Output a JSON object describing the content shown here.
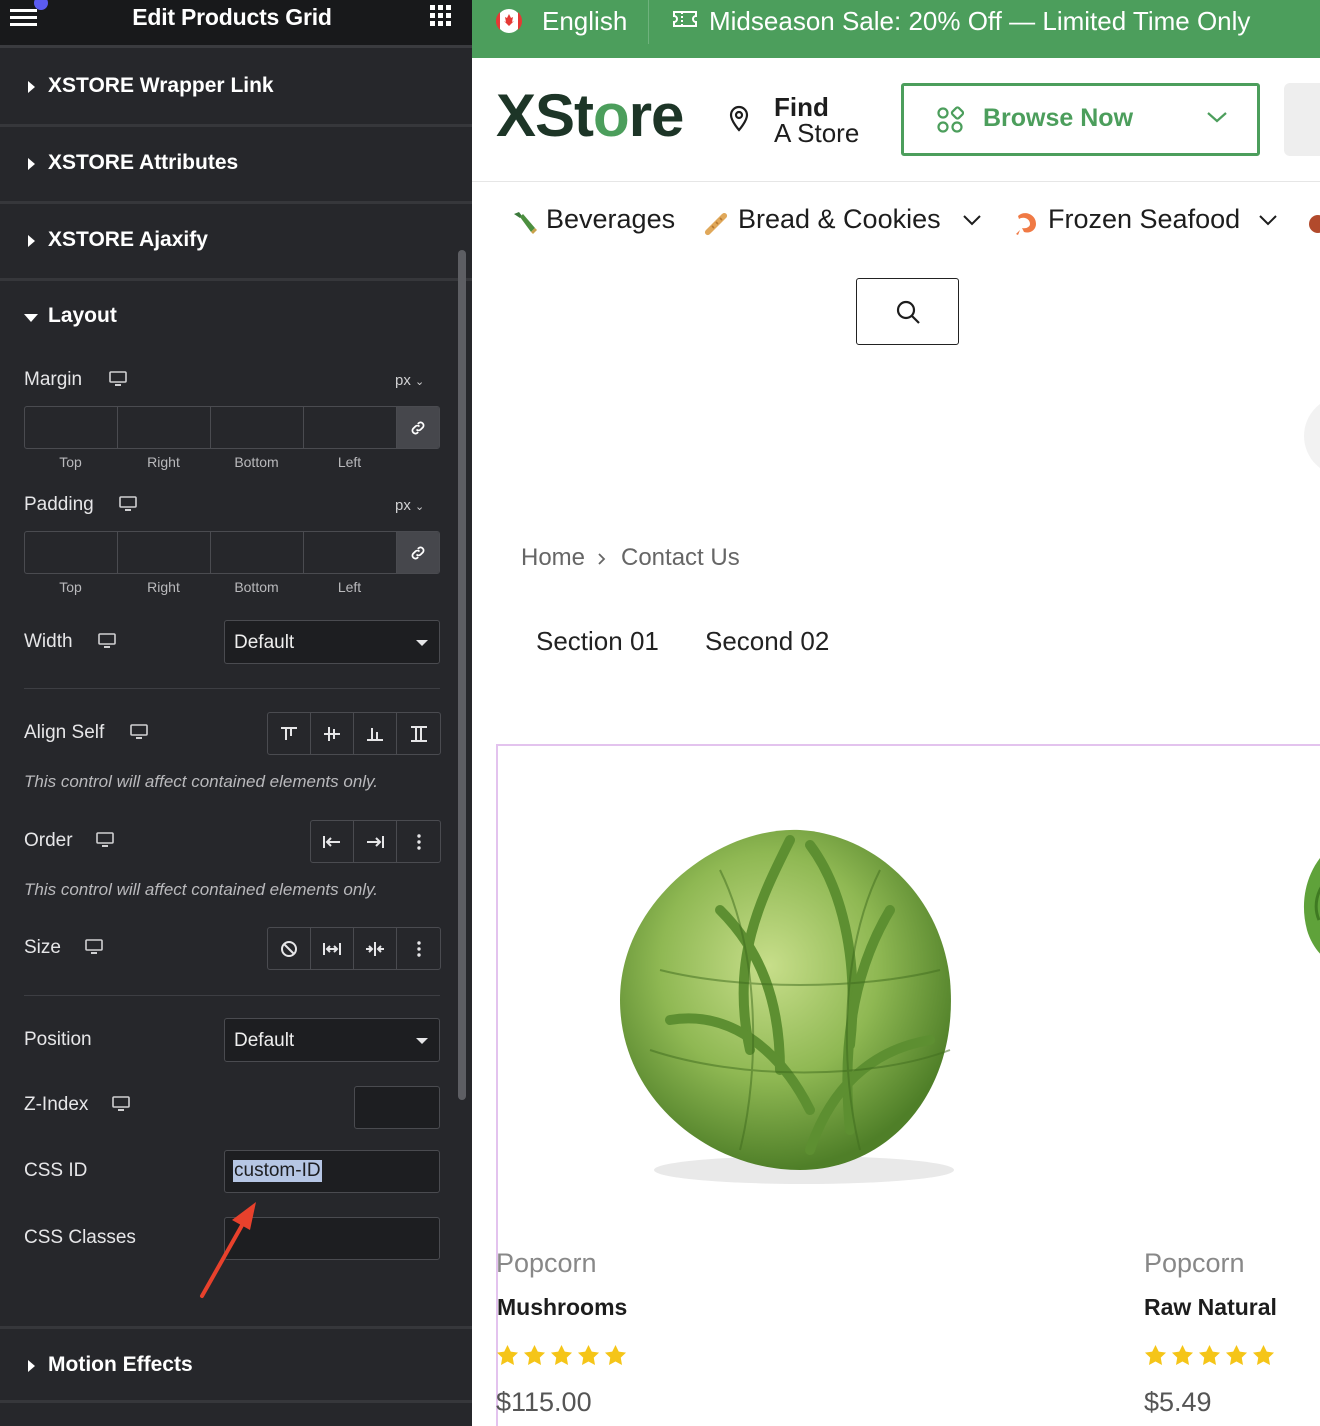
{
  "editor": {
    "title": "Edit Products Grid",
    "sections_collapsed": [
      "XSTORE Wrapper Link",
      "XSTORE Attributes",
      "XSTORE Ajaxify"
    ],
    "layout_title": "Layout",
    "margin": {
      "label": "Margin",
      "unit": "px",
      "sides": [
        "Top",
        "Right",
        "Bottom",
        "Left"
      ]
    },
    "padding": {
      "label": "Padding",
      "unit": "px",
      "sides": [
        "Top",
        "Right",
        "Bottom",
        "Left"
      ]
    },
    "width": {
      "label": "Width",
      "value": "Default"
    },
    "align_self": {
      "label": "Align Self",
      "note": "This control will affect contained elements only."
    },
    "order": {
      "label": "Order",
      "note": "This control will affect contained elements only."
    },
    "size": {
      "label": "Size"
    },
    "position": {
      "label": "Position",
      "value": "Default"
    },
    "z_index": {
      "label": "Z-Index",
      "value": ""
    },
    "css_id": {
      "label": "CSS ID",
      "value": "custom-ID"
    },
    "css_classes": {
      "label": "CSS Classes",
      "value": ""
    },
    "motion_effects": "Motion Effects"
  },
  "store": {
    "language": "English",
    "promo": "Midseason Sale: 20% Off — Limited Time Only",
    "logo_prefix": "XSt",
    "logo_leaf": "o",
    "logo_suffix": "re",
    "find_line1": "Find",
    "find_line2": "A Store",
    "browse_label": "Browse Now",
    "categories": [
      "Beverages",
      "Bread & Cookies",
      "Frozen Seafood"
    ],
    "breadcrumb": [
      "Home",
      "Contact Us"
    ],
    "tabs": [
      "Section 01",
      "Second 02"
    ],
    "products": [
      {
        "category": "Popcorn",
        "name": "Mushrooms",
        "rating": 5,
        "price": "$115.00"
      },
      {
        "category": "Popcorn",
        "name": "Raw Natural",
        "rating": 5,
        "price": "$5.49"
      }
    ]
  },
  "colors": {
    "brand_green": "#4c9e5c",
    "panel_bg": "#26272b",
    "star": "#f5c518",
    "annotation_arrow": "#e8412c"
  }
}
